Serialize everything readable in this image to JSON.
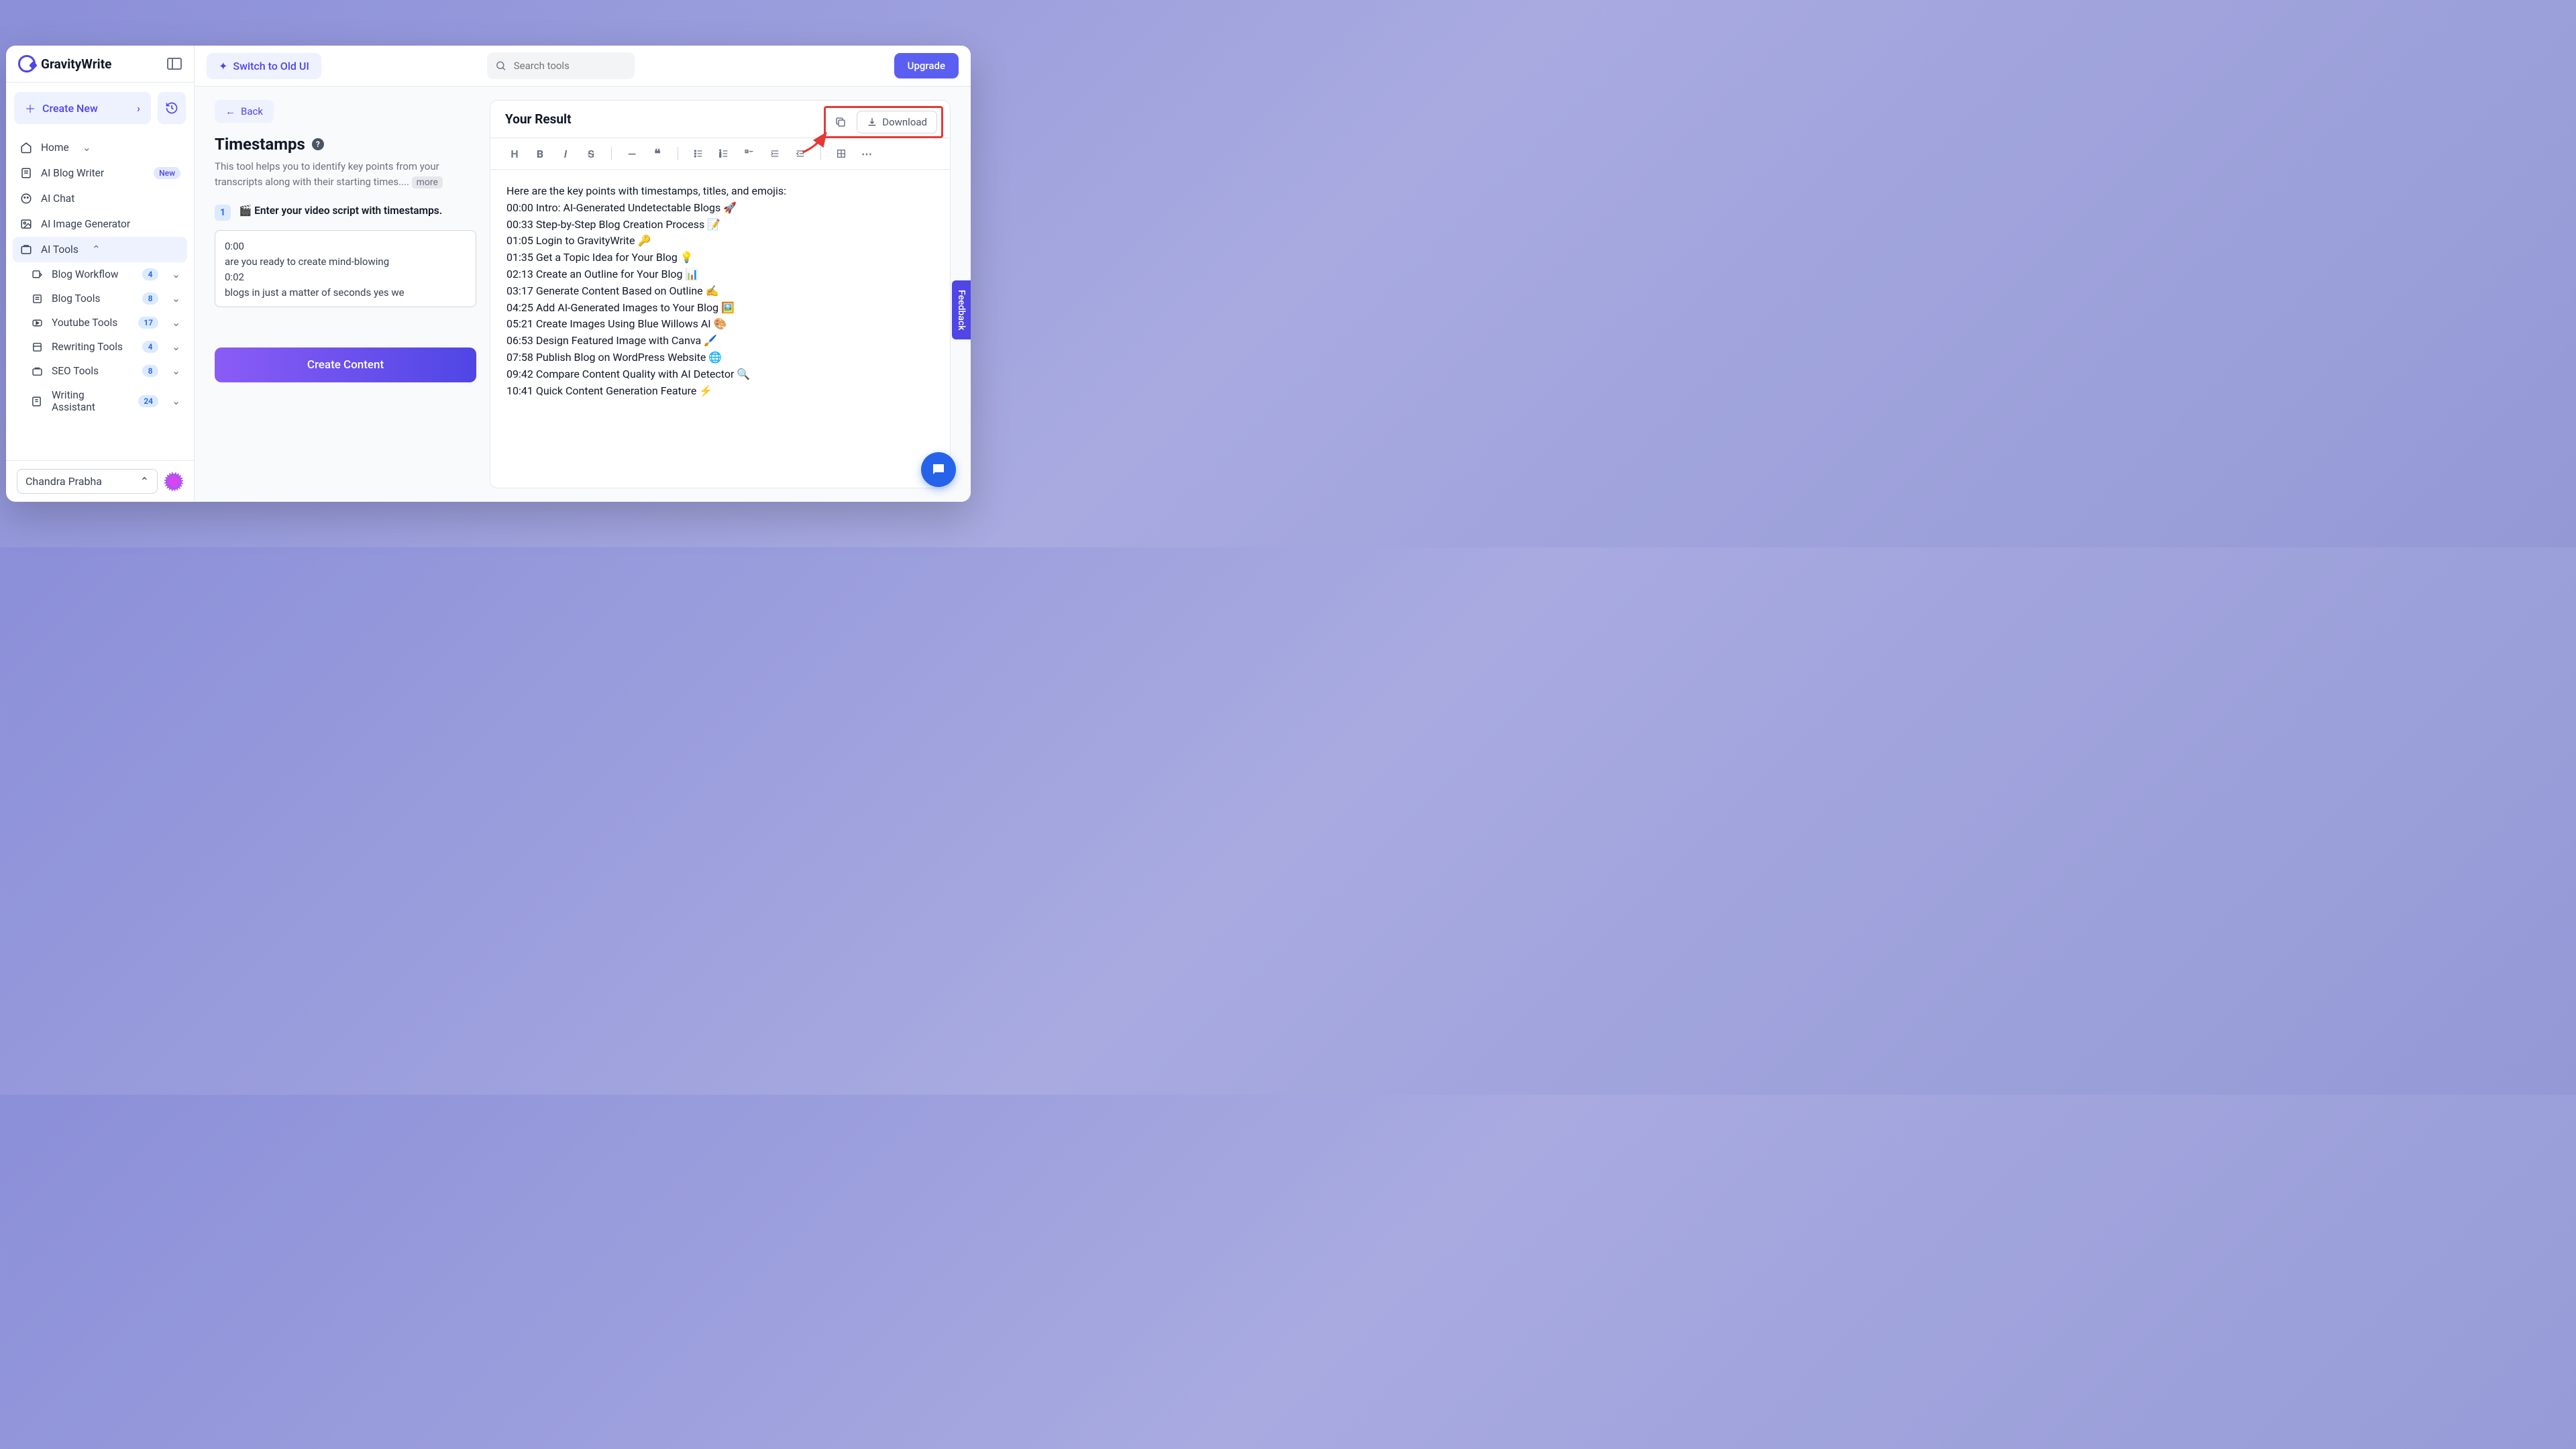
{
  "brand": "GravityWrite",
  "sidebar": {
    "create_label": "Create New",
    "items": [
      {
        "label": "Home"
      },
      {
        "label": "AI Blog Writer",
        "badge_new": "New"
      },
      {
        "label": "AI Chat"
      },
      {
        "label": "AI Image Generator"
      },
      {
        "label": "AI Tools"
      }
    ],
    "sub_items": [
      {
        "label": "Blog Workflow",
        "count": "4"
      },
      {
        "label": "Blog Tools",
        "count": "8"
      },
      {
        "label": "Youtube Tools",
        "count": "17"
      },
      {
        "label": "Rewriting Tools",
        "count": "4"
      },
      {
        "label": "SEO Tools",
        "count": "8"
      },
      {
        "label": "Writing Assistant",
        "count": "24"
      }
    ],
    "user_name": "Chandra Prabha"
  },
  "topbar": {
    "switch_label": "Switch to Old UI",
    "search_placeholder": "Search tools",
    "upgrade_label": "Upgrade"
  },
  "tool": {
    "back_label": "Back",
    "title": "Timestamps",
    "description": "This tool helps you to identify key points from your transcripts along with their starting times....",
    "more_label": "more",
    "step_number": "1",
    "step_label": "🎬 Enter your video script with timestamps.",
    "script_value": "0:00\nare you ready to create mind-blowing\n0:02\nblogs in just a matter of seconds yes we",
    "create_content_label": "Create Content"
  },
  "result": {
    "header": "Your Result",
    "download_label": "Download",
    "intro_line": "Here are the key points with timestamps, titles, and emojis:",
    "lines": [
      "00:00 Intro: AI-Generated Undetectable Blogs 🚀",
      "00:33 Step-by-Step Blog Creation Process 📝",
      "01:05 Login to GravityWrite 🔑",
      "01:35 Get a Topic Idea for Your Blog 💡",
      "02:13 Create an Outline for Your Blog 📊",
      "03:17 Generate Content Based on Outline ✍️",
      "04:25 Add AI-Generated Images to Your Blog 🖼️",
      "05:21 Create Images Using Blue Willows AI 🎨",
      "06:53 Design Featured Image with Canva 🖌️",
      "07:58 Publish Blog on WordPress Website 🌐",
      "09:42 Compare Content Quality with AI Detector 🔍",
      "10:41 Quick Content Generation Feature ⚡"
    ]
  },
  "feedback_label": "Feedback"
}
